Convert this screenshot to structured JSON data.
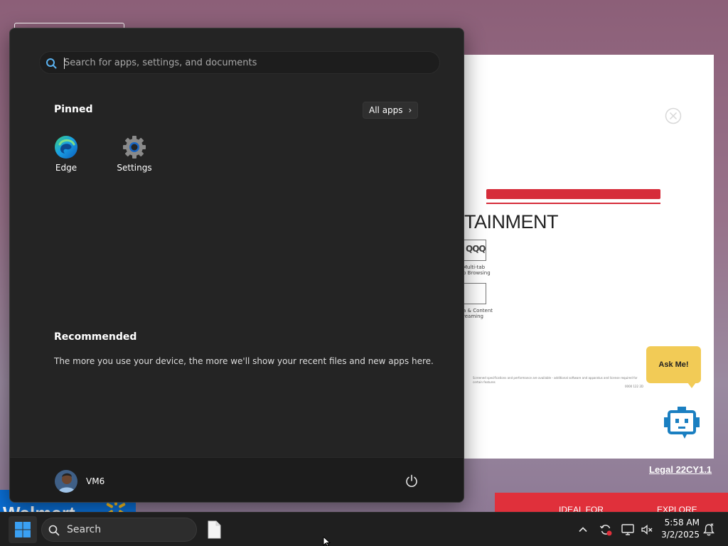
{
  "background_page": {
    "heading": "TAINMENT",
    "features": [
      {
        "icon_text": "QQQ",
        "label": "Multi-tab\nb Browsing"
      },
      {
        "icon_text": "",
        "label": "a & Content\nreaming"
      }
    ],
    "fine_print": "Screened specifications and performance are available - additional software and apparatus and license required for certain features",
    "fine_print_2": "0000 122 2D",
    "ask_me": "Ask Me!",
    "legal": "Legal 22CY1.1",
    "walmart": "Walmart",
    "promos": [
      "IDEAL FOR",
      "EXPLORE"
    ],
    "colors": {
      "red_bar": "#d62c3a",
      "ask_me_bg": "#f2cb56",
      "walmart_blue": "#0a6fd6",
      "walmart_spark": "#ffc220"
    }
  },
  "start_menu": {
    "search_placeholder": "Search for apps, settings, and documents",
    "pinned_label": "Pinned",
    "all_apps_label": "All apps",
    "pinned_apps": [
      {
        "label": "Edge",
        "icon": "edge-icon"
      },
      {
        "label": "Settings",
        "icon": "settings-gear-icon"
      }
    ],
    "recommended_label": "Recommended",
    "recommended_text": "The more you use your device, the more we'll show your recent files and new apps here.",
    "user_name": "VM6",
    "power_icon": "power-icon"
  },
  "taskbar": {
    "search_label": "Search",
    "time": "5:58 AM",
    "date": "3/2/2025",
    "accent": "#3aa0f3"
  }
}
